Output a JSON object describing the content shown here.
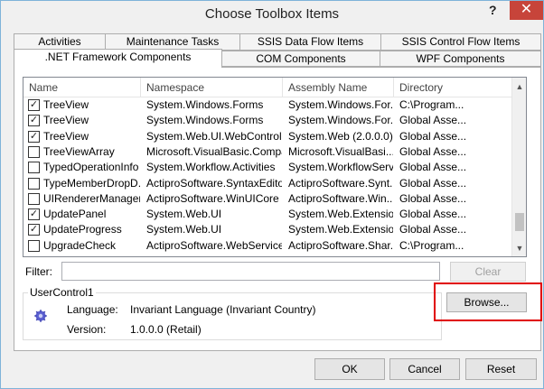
{
  "window": {
    "title": "Choose Toolbox Items",
    "help": "?",
    "close": "✕"
  },
  "tabs_top": [
    "Activities",
    "Maintenance Tasks",
    "SSIS Data Flow Items",
    "SSIS Control Flow Items"
  ],
  "tabs_bottom": [
    ".NET Framework Components",
    "COM Components",
    "WPF Components"
  ],
  "columns": [
    "Name",
    "Namespace",
    "Assembly Name",
    "Directory"
  ],
  "rows": [
    {
      "checked": true,
      "name": "TreeView",
      "ns": "System.Windows.Forms",
      "asm": "System.Windows.For...",
      "dir": "C:\\Program..."
    },
    {
      "checked": true,
      "name": "TreeView",
      "ns": "System.Windows.Forms",
      "asm": "System.Windows.For...",
      "dir": "Global Asse..."
    },
    {
      "checked": true,
      "name": "TreeView",
      "ns": "System.Web.UI.WebControls",
      "asm": "System.Web (2.0.0.0)",
      "dir": "Global Asse..."
    },
    {
      "checked": false,
      "name": "TreeViewArray",
      "ns": "Microsoft.VisualBasic.Compa...",
      "asm": "Microsoft.VisualBasi...",
      "dir": "Global Asse..."
    },
    {
      "checked": false,
      "name": "TypedOperationInfo",
      "ns": "System.Workflow.Activities",
      "asm": "System.WorkflowServ...",
      "dir": "Global Asse..."
    },
    {
      "checked": false,
      "name": "TypeMemberDropD...",
      "ns": "ActiproSoftware.SyntaxEditor...",
      "asm": "ActiproSoftware.Synt...",
      "dir": "Global Asse..."
    },
    {
      "checked": false,
      "name": "UIRendererManager",
      "ns": "ActiproSoftware.WinUICore",
      "asm": "ActiproSoftware.Win...",
      "dir": "Global Asse..."
    },
    {
      "checked": true,
      "name": "UpdatePanel",
      "ns": "System.Web.UI",
      "asm": "System.Web.Extensio...",
      "dir": "Global Asse..."
    },
    {
      "checked": true,
      "name": "UpdateProgress",
      "ns": "System.Web.UI",
      "asm": "System.Web.Extensio...",
      "dir": "Global Asse..."
    },
    {
      "checked": false,
      "name": "UpgradeCheck",
      "ns": "ActiproSoftware.WebServices",
      "asm": "ActiproSoftware.Shar...",
      "dir": "C:\\Program..."
    }
  ],
  "filter": {
    "label": "Filter:",
    "value": ""
  },
  "buttons": {
    "clear": "Clear",
    "browse": "Browse...",
    "ok": "OK",
    "cancel": "Cancel",
    "reset": "Reset"
  },
  "details": {
    "group_title": "UserControl1",
    "language_label": "Language:",
    "language_value": "Invariant Language (Invariant Country)",
    "version_label": "Version:",
    "version_value": "1.0.0.0 (Retail)"
  },
  "icons": {
    "gear": "gear-icon"
  }
}
